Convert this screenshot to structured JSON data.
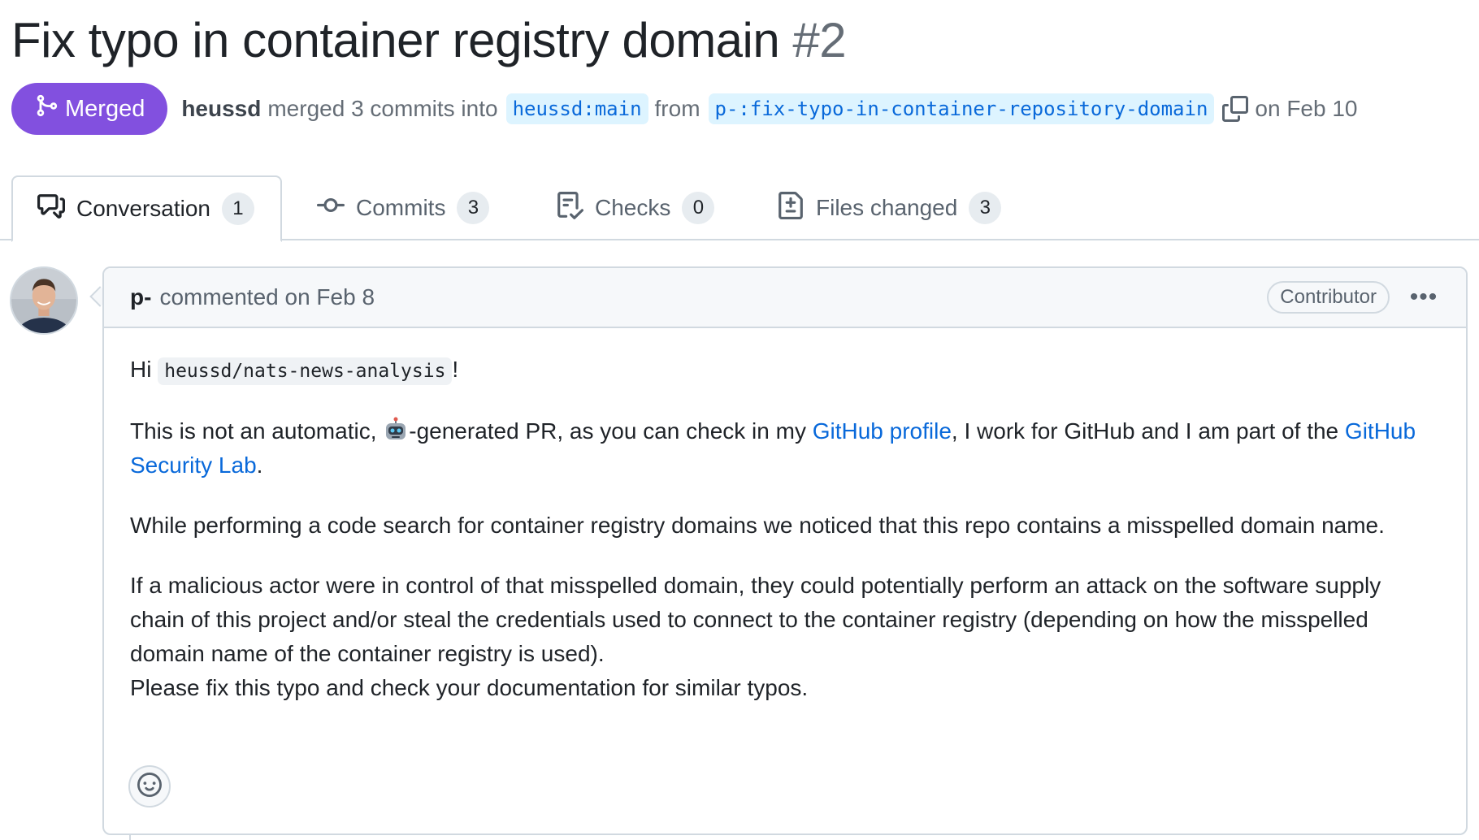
{
  "pr": {
    "title": "Fix typo in container registry domain",
    "number": "#2"
  },
  "meta": {
    "status_label": "Merged",
    "author": "heussd",
    "action_text": "merged 3 commits into",
    "base_branch": "heussd:main",
    "from_text": "from",
    "head_branch": "p-:fix-typo-in-container-repository-domain",
    "date_text": "on Feb 10"
  },
  "tabs": [
    {
      "label": "Conversation",
      "count": "1",
      "icon": "comment-discussion-icon"
    },
    {
      "label": "Commits",
      "count": "3",
      "icon": "git-commit-icon"
    },
    {
      "label": "Checks",
      "count": "0",
      "icon": "checklist-icon"
    },
    {
      "label": "Files changed",
      "count": "3",
      "icon": "file-diff-icon"
    }
  ],
  "comment": {
    "author": "p-",
    "action": "commented on Feb 8",
    "role": "Contributor",
    "menu": "•••",
    "greeting_prefix": "Hi",
    "greeting_code": "heussd/nats-news-analysis",
    "greeting_suffix": "!",
    "p2_before_emoji": "This is not an automatic,",
    "p2_after_emoji": "-generated PR, as you can check in my",
    "p2_link1": "GitHub profile",
    "p2_middle": ", I work for GitHub and I am part of the",
    "p2_link2": "GitHub Security Lab",
    "p2_end": ".",
    "p3": "While performing a code search for container registry domains we noticed that this repo contains a misspelled domain name.",
    "p4": "If a malicious actor were in control of that misspelled domain, they could potentially perform an attack on the software supply chain of this project and/or steal the credentials used to connect to the container registry (depending on how the misspelled domain name of the container registry is used).",
    "p5": "Please fix this typo and check your documentation for similar typos."
  },
  "colors": {
    "merged": "#8250df",
    "link": "#0969da",
    "border": "#d1d9e0",
    "header_bg": "#f6f8fa"
  }
}
